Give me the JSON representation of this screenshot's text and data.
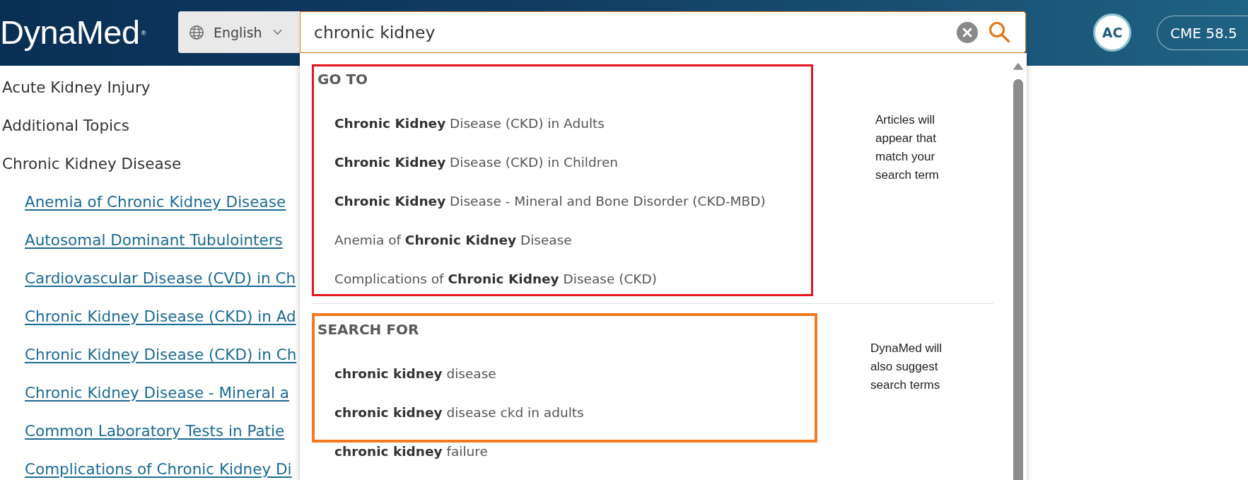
{
  "header": {
    "logo": "DynaMed$^{®}$",
    "language": {
      "label": "English"
    },
    "search": {
      "value": "chronic kidney"
    },
    "avatar": {
      "initials": "AC"
    },
    "cme": {
      "label": "CME 58.5"
    }
  },
  "topics": [
    {
      "title": "Acute Kidney Injury"
    },
    {
      "title": "Additional Topics"
    },
    {
      "title": "Chronic Kidney Disease",
      "children": [
        {
          "title": "Anemia of Chronic Kidney Disease"
        },
        {
          "title": "Autosomal Dominant Tubulointers"
        },
        {
          "title": "Cardiovascular Disease (CVD) in Ch"
        },
        {
          "title": "Chronic Kidney Disease (CKD) in Ad"
        },
        {
          "title": "Chronic Kidney Disease (CKD) in Ch"
        },
        {
          "title": "Chronic Kidney Disease - Mineral a"
        },
        {
          "title": "Common Laboratory Tests in Patie"
        },
        {
          "title": "Complications of Chronic Kidney Di"
        }
      ]
    }
  ],
  "dropdown": {
    "sections": [
      {
        "heading": "GO TO",
        "color": "#e8141f",
        "items": [
          "**Chronic Kidney** Disease (CKD) in Adults",
          "**Chronic Kidney** Disease (CKD) in Children",
          "**Chronic Kidney** Disease - Mineral and Bone Disorder (CKD-MBD)",
          "Anemia of **Chronic Kidney** Disease",
          "Complications of **Chronic Kidney** Disease (CKD)"
        ],
        "note": "Articles will appear that match your search term"
      },
      {
        "heading": "SEARCH FOR",
        "color": "#f47920",
        "items": [
          "**chronic kidney** disease",
          "**chronic kidney** disease ckd in adults",
          "**chronic kidney** failure"
        ],
        "note": "DynaMed will also suggest search terms"
      }
    ]
  }
}
